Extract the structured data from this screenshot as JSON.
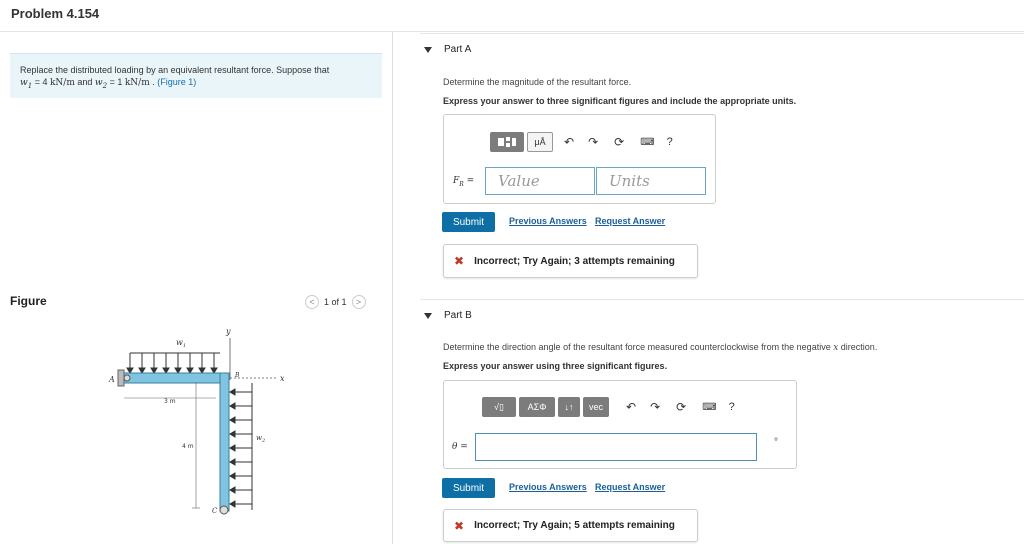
{
  "header": {
    "title": "Problem 4.154"
  },
  "prompt": {
    "text1": "Replace the distributed loading by an equivalent resultant force. Suppose that",
    "w1_sym": "w",
    "w1_sub": "1",
    "w1_val": " = 4 ",
    "unit": "kN/m",
    "and": " and ",
    "w2_sym": "w",
    "w2_sub": "2",
    "w2_val": " = 1 ",
    "period": " . ",
    "figure_link": "(Figure 1)"
  },
  "figure": {
    "label": "Figure",
    "pager_text": "1 of 1",
    "prev_glyph": "<",
    "next_glyph": ">",
    "labels": {
      "w1": "w",
      "w1_sub": "1",
      "w2": "w",
      "w2_sub": "2",
      "y": "y",
      "x": "x",
      "A": "A",
      "B": "B",
      "C": "C",
      "dim3": "3 m",
      "dim4": "4 m"
    }
  },
  "partA": {
    "header": "Part A",
    "question": "Determine the magnitude of the resultant force.",
    "instruction": "Express your answer to three significant figures and include the appropriate units.",
    "toolbar": {
      "units_btn": "μÅ",
      "help": "?"
    },
    "field_label": "F",
    "field_label_sub": "R",
    "field_eq": " =",
    "value_placeholder": "Value",
    "units_placeholder": "Units",
    "submit": "Submit",
    "prev_answers": "Previous Answers",
    "request_answer": "Request Answer",
    "feedback": "Incorrect; Try Again; 3 attempts remaining"
  },
  "partB": {
    "header": "Part B",
    "question_pre": "Determine the direction angle of the resultant force measured counterclockwise from the negative ",
    "question_var": "x",
    "question_post": " direction.",
    "instruction": "Express your answer using three significant figures.",
    "toolbar": {
      "sqrt_btn": "√▯",
      "greek_btn": "ΑΣΦ",
      "arrows_btn": "↓↑",
      "vec_btn": "vec",
      "help": "?"
    },
    "field_label": "θ =",
    "unit_symbol": "°",
    "submit": "Submit",
    "prev_answers": "Previous Answers",
    "request_answer": "Request Answer",
    "feedback": "Incorrect; Try Again; 5 attempts remaining"
  },
  "colors": {
    "accent": "#0e6fa6",
    "error": "#c0392b",
    "prompt_bg": "#e9f5f8",
    "beam": "#7fc4e0"
  }
}
